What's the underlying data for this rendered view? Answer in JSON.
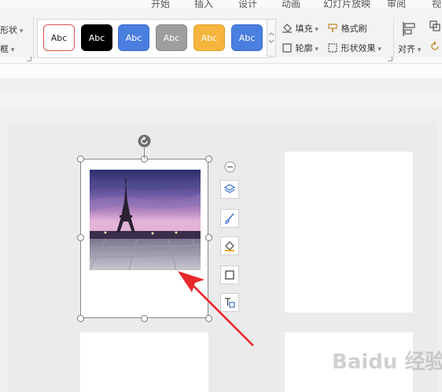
{
  "menu": {
    "tabs": [
      "开始",
      "插入",
      "设计",
      "动画",
      "幻灯片放映",
      "审阅",
      "视"
    ]
  },
  "ribbon": {
    "left": {
      "shape_label": "形状",
      "frame_label": "框"
    },
    "style_gallery": [
      {
        "label": "Abc",
        "bg": "#ffffff",
        "fg": "#222222",
        "border": "#d9534f"
      },
      {
        "label": "Abc",
        "bg": "#000000",
        "fg": "#ffffff",
        "border": "#000000"
      },
      {
        "label": "Abc",
        "bg": "#4a7fe0",
        "fg": "#ffffff",
        "border": "#3a6fcf"
      },
      {
        "label": "Abc",
        "bg": "#9e9e9e",
        "fg": "#ffffff",
        "border": "#8a8a8a"
      },
      {
        "label": "Abc",
        "bg": "#f5b53d",
        "fg": "#ffffff",
        "border": "#e0a12a"
      },
      {
        "label": "Abc",
        "bg": "#4a7fe0",
        "fg": "#ffffff",
        "border": "#3a6fcf"
      }
    ],
    "fill_label": "填充",
    "outline_label": "轮廓",
    "format_painter_label": "格式刷",
    "shape_effects_label": "形状效果",
    "align_label": "对齐"
  },
  "watermark": {
    "text": "Baidu 经验"
  },
  "colors": {
    "arrow": "#e8272b",
    "accent": "#4a7fe0"
  }
}
